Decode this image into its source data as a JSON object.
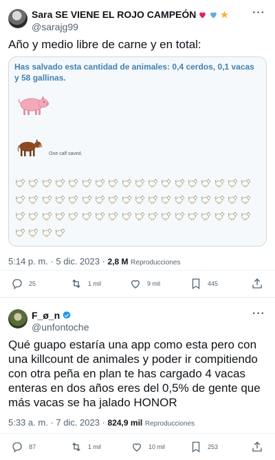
{
  "tweet1": {
    "name": "Sara SE VIENE EL ROJO CAMPEÓN",
    "handle": "@sarajg99",
    "text": "Año y medio libre de carne y en total:",
    "embed": {
      "title": "Has salvado esta cantidad de animales: 0,4 cerdos, 0,1 vacas y 58 gallinas.",
      "calf_caption": "One calf saved.",
      "hen_count": 58
    },
    "time": "5:14 p. m. · 5 dic. 2023 · ",
    "views_count": "2,8 M",
    "views_label": "Reproducciones",
    "actions": {
      "replies": "25",
      "retweets": "1 mil",
      "likes": "9 mil",
      "bookmarks": "445"
    },
    "emoji_colors": {
      "heart_red": "#e0245e",
      "heart_blue": "#5dadec",
      "star": "#ffac33"
    }
  },
  "tweet2": {
    "name": "F_ø_n",
    "handle": "@unfontoche",
    "text": "Qué guapo estaría una app como esta pero con una killcount de animales y poder ir compitiendo con otra peña en plan te has cargado 4 vacas enteras en dos años eres del 0,5% de gente que más vacas se ha jalado HONOR",
    "time": "5:33 a. m. · 7 dic. 2023 · ",
    "views_count": "824,9 mil",
    "views_label": "Reproducciones",
    "actions": {
      "replies": "87",
      "retweets": "1 mil",
      "likes": "10 mil",
      "bookmarks": "253"
    },
    "verified_color": "#1d9bf0"
  }
}
